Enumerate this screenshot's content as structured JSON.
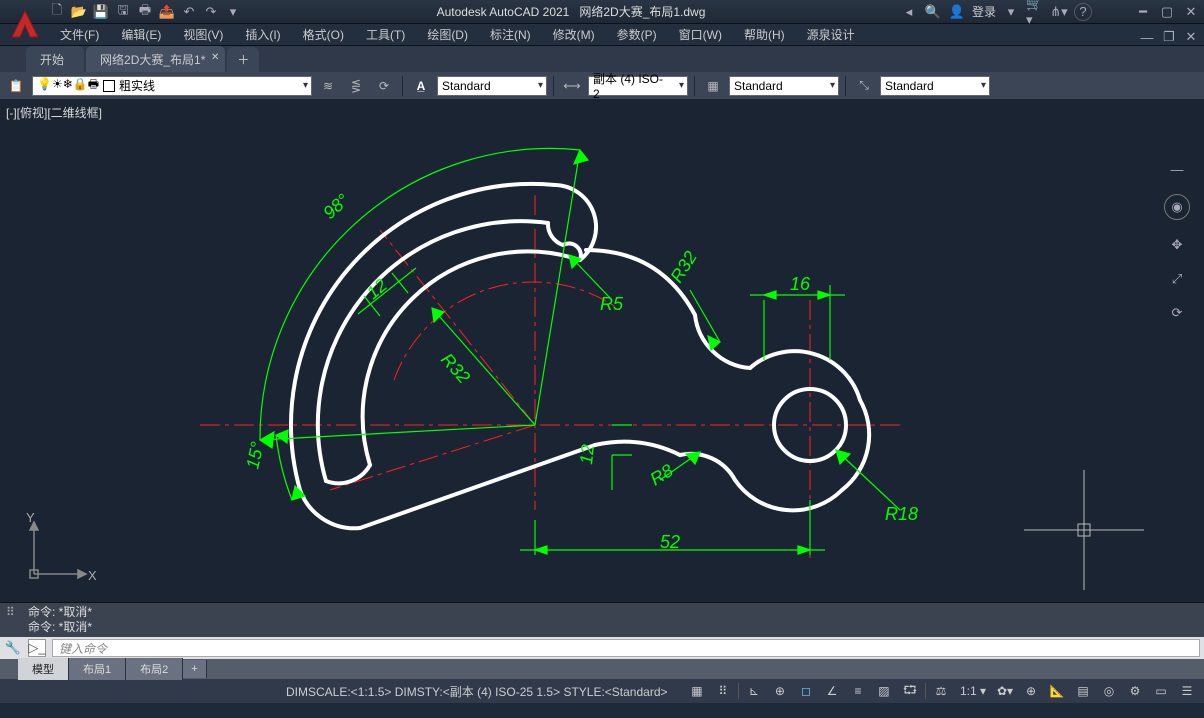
{
  "title": {
    "app": "Autodesk AutoCAD 2021",
    "file": "网络2D大赛_布局1.dwg",
    "login": "登录"
  },
  "menu": {
    "file": "文件(F)",
    "edit": "编辑(E)",
    "view": "视图(V)",
    "insert": "插入(I)",
    "format": "格式(O)",
    "tools": "工具(T)",
    "draw": "绘图(D)",
    "dimension": "标注(N)",
    "modify": "修改(M)",
    "param": "参数(P)",
    "window": "窗口(W)",
    "help": "帮助(H)",
    "yuan": "源泉设计"
  },
  "tabs": {
    "start": "开始",
    "doc": "网络2D大赛_布局1*"
  },
  "toolbar": {
    "linetype": "粗实线",
    "textstyle": "Standard",
    "dimstyle": "副本 (4) ISO-2",
    "tablestyle": "Standard",
    "mlstyle": "Standard"
  },
  "viewport": {
    "label": "[-][俯视][二维线框]"
  },
  "dimensions": {
    "d98": "98°",
    "d15": "15°",
    "d12a": "12",
    "d12b": "12",
    "r32a": "R32",
    "r32b": "R32",
    "r5": "R5",
    "r8": "R8",
    "r18": "R18",
    "d16": "16",
    "d52": "52"
  },
  "command": {
    "hist1": "命令:  *取消*",
    "hist2": "命令:  *取消*",
    "placeholder": "键入命令"
  },
  "layout": {
    "model": "模型",
    "l1": "布局1",
    "l2": "布局2"
  },
  "status": {
    "text": "DIMSCALE:<1:1.5> DIMSTY:<副本 (4) ISO-25 1.5> STYLE:<Standard>",
    "scale": "1:1 ▾"
  }
}
